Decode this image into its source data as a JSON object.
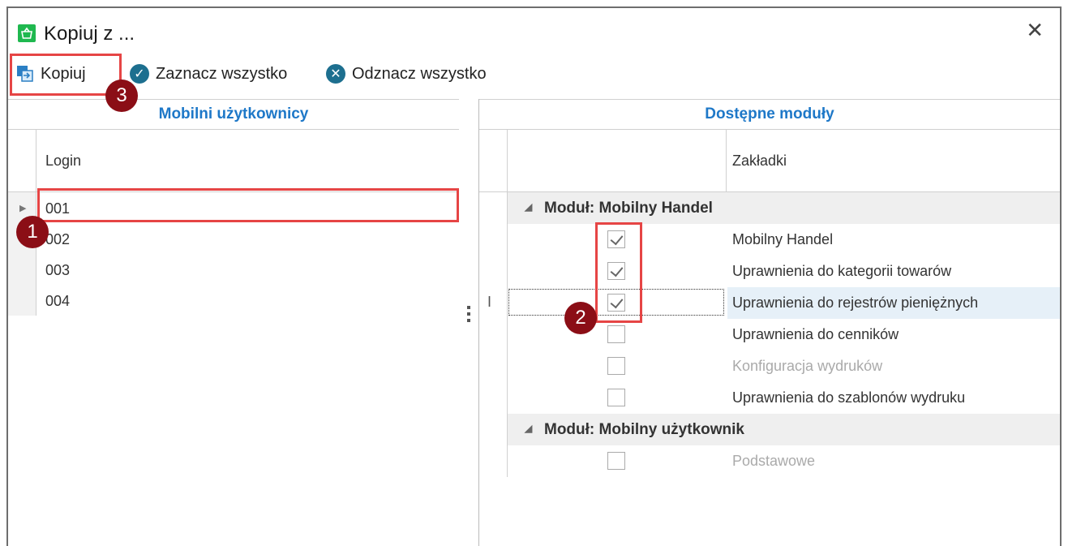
{
  "window": {
    "title": "Kopiuj z ..."
  },
  "toolbar": {
    "copy_label": "Kopiuj",
    "select_all_label": "Zaznacz wszystko",
    "deselect_all_label": "Odznacz wszystko"
  },
  "left_panel": {
    "header": "Mobilni użytkownicy",
    "column_label": "Login",
    "rows": [
      "001",
      "002",
      "003",
      "004"
    ]
  },
  "right_panel": {
    "header": "Dostępne moduły",
    "column_label": "Zakładki",
    "groups": [
      {
        "label": "Moduł: Mobilny Handel",
        "items": [
          {
            "label": "Mobilny Handel",
            "checked": true,
            "muted": false
          },
          {
            "label": "Uprawnienia do kategorii towarów",
            "checked": true,
            "muted": false
          },
          {
            "label": "Uprawnienia do rejestrów pieniężnych",
            "checked": true,
            "muted": false
          },
          {
            "label": "Uprawnienia do cenników",
            "checked": false,
            "muted": false
          },
          {
            "label": "Konfiguracja wydruków",
            "checked": false,
            "muted": true
          },
          {
            "label": "Uprawnienia do szablonów wydruku",
            "checked": false,
            "muted": false
          }
        ]
      },
      {
        "label": "Moduł: Mobilny użytkownik",
        "items": [
          {
            "label": "Podstawowe",
            "checked": false,
            "muted": true
          }
        ]
      }
    ]
  },
  "annotations": {
    "badge1": "1",
    "badge2": "2",
    "badge3": "3"
  },
  "colors": {
    "accent_blue": "#1e78c8",
    "callout_red": "#e64545",
    "badge_red": "#8b0e16",
    "app_green": "#1fb84f"
  },
  "icons": [
    "app-basket-icon",
    "close-icon",
    "copy-icon",
    "check-circle-icon",
    "x-circle-icon",
    "collapse-triangle-icon",
    "row-pointer-icon",
    "text-cursor-icon"
  ]
}
